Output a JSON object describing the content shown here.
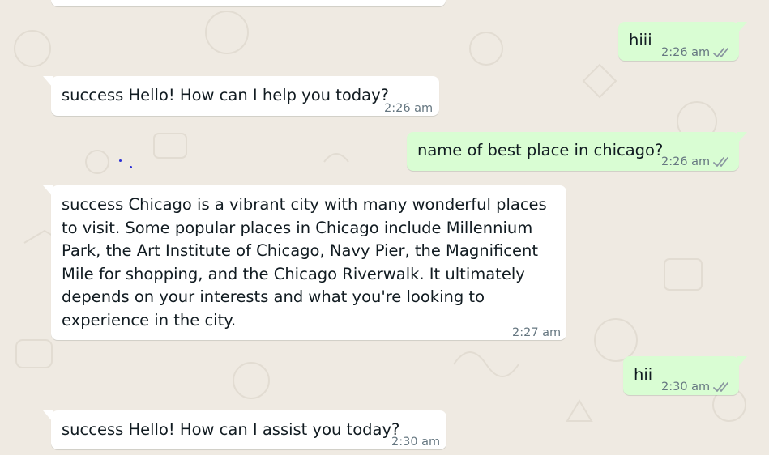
{
  "colors": {
    "background": "#efeae2",
    "incoming_bubble": "#ffffff",
    "outgoing_bubble": "#d9fdd3",
    "meta_text": "#667781",
    "message_text": "#111b21"
  },
  "messages": [
    {
      "direction": "out",
      "text": "hiii",
      "time": "2:26 am",
      "status_icon": "double-check-icon"
    },
    {
      "direction": "in",
      "text": "success Hello! How can I help you today?",
      "time": "2:26 am"
    },
    {
      "direction": "out",
      "text": "name of best place in chicago?",
      "time": "2:26 am",
      "status_icon": "double-check-icon"
    },
    {
      "direction": "in",
      "text": "success Chicago is a vibrant city with many wonderful places to visit. Some popular places in Chicago include Millennium Park, the Art Institute of Chicago, Navy Pier, the Magnificent Mile for shopping, and the Chicago Riverwalk. It ultimately depends on your interests and what you're looking to experience in the city.",
      "time": "2:27 am"
    },
    {
      "direction": "out",
      "text": "hii",
      "time": "2:30 am",
      "status_icon": "double-check-icon"
    },
    {
      "direction": "in",
      "text": "success Hello! How can I assist you today?",
      "time": "2:30 am"
    }
  ]
}
